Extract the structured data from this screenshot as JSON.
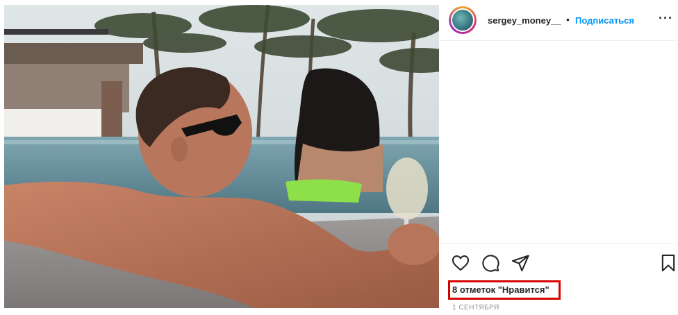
{
  "post": {
    "username": "sergey_money__",
    "separator": "•",
    "follow_label": "Подписаться",
    "more_label": "···",
    "likes_text": "8 отметок \"Нравится\"",
    "date_text": "1 сентября",
    "highlight_color": "#d60000",
    "follow_color": "#0095f6"
  },
  "icons": {
    "like": "heart-icon",
    "comment": "comment-icon",
    "share": "send-icon",
    "save": "bookmark-icon"
  }
}
